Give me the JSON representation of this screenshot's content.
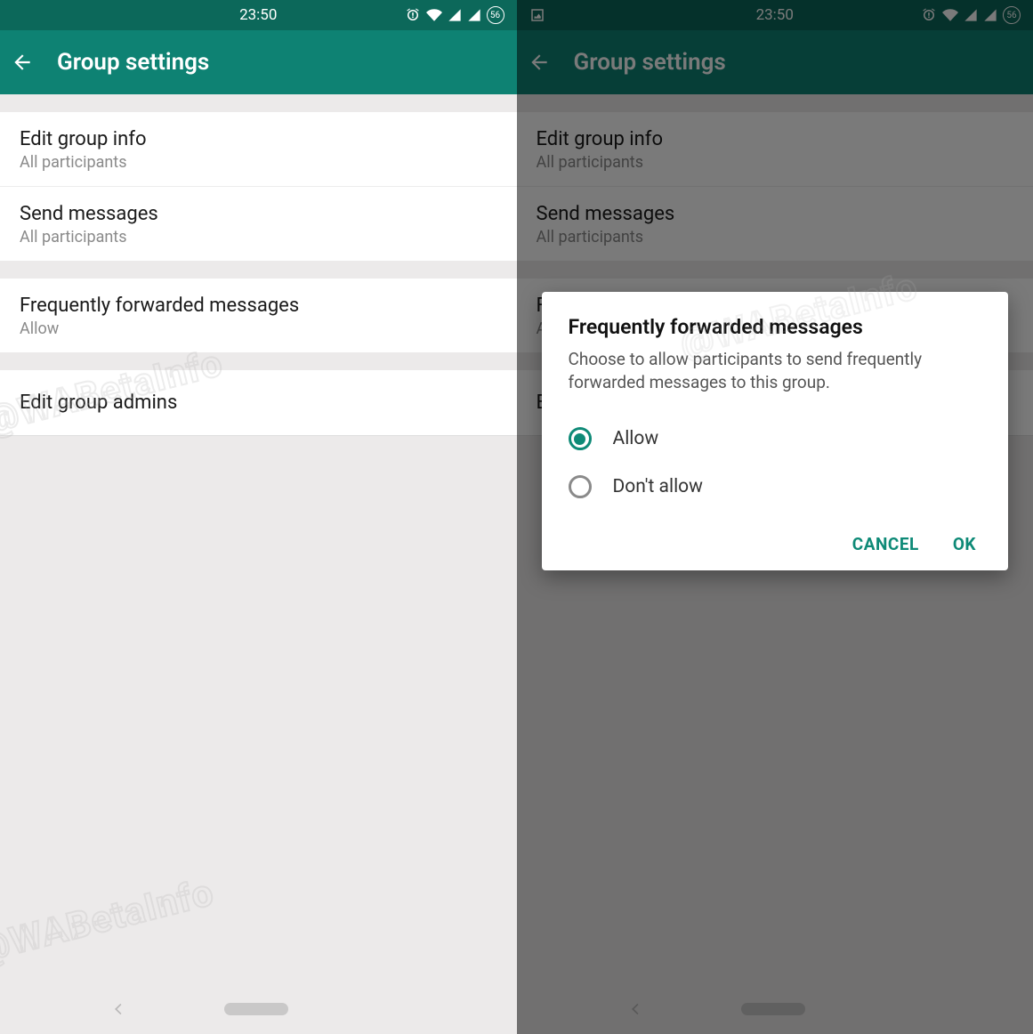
{
  "status": {
    "time": "23:50",
    "battery_label": "56"
  },
  "appbar": {
    "title": "Group settings"
  },
  "settings": {
    "items": [
      {
        "title": "Edit group info",
        "subtitle": "All participants"
      },
      {
        "title": "Send messages",
        "subtitle": "All participants"
      },
      {
        "title": "Frequently forwarded messages",
        "subtitle": "Allow"
      },
      {
        "title": "Edit group admins",
        "subtitle": ""
      }
    ]
  },
  "dialog": {
    "title": "Frequently forwarded messages",
    "description": "Choose to allow participants to send frequently forwarded messages to this group.",
    "options": [
      {
        "label": "Allow",
        "selected": true
      },
      {
        "label": "Don't allow",
        "selected": false
      }
    ],
    "cancel_label": "CANCEL",
    "ok_label": "OK"
  },
  "watermark": "@WABetaInfo"
}
